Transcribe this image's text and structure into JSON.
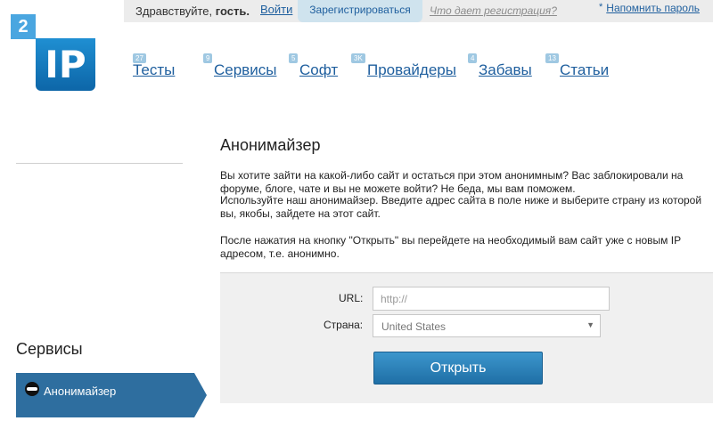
{
  "topbar": {
    "greeting": "Здравствуйте,",
    "username": "гость.",
    "login": "Войти",
    "register": "Зарегистрироваться",
    "register_info": "Что дает регистрация?",
    "remind_star": "*",
    "remind": "Напомнить пароль"
  },
  "logo": {
    "top": "2",
    "main": "IP"
  },
  "nav": [
    {
      "badge": "27",
      "label": "Тесты"
    },
    {
      "badge": "9",
      "label": "Сервисы"
    },
    {
      "badge": "5",
      "label": "Софт"
    },
    {
      "badge": "3K",
      "label": "Провайдеры"
    },
    {
      "badge": "4",
      "label": "Забавы"
    },
    {
      "badge": "13",
      "label": "Статьи"
    }
  ],
  "sidebar": {
    "title": "Сервисы",
    "active_item": {
      "label": "Анонимайзер",
      "icon": "ninja-icon"
    }
  },
  "main": {
    "title": "Анонимайзер",
    "para1": "Вы хотите зайти на какой-либо сайт и остаться при этом анонимным? Вас заблокировали на форуме, блоге, чате и вы не можете войти? Не беда, мы вам поможем.",
    "para2": "Используйте наш анонимайзер. Введите адрес сайта в поле ниже и выберите страну из которой вы, якобы, зайдете на этот сайт.",
    "para3": "После нажатия на кнопку \"Открыть\" вы перейдете на необходимый вам сайт уже с новым IP адресом, т.е. анонимно."
  },
  "form": {
    "url_label": "URL:",
    "url_placeholder": "http://",
    "url_value": "",
    "country_label": "Страна:",
    "country_value": "United States",
    "select_arrow": "▼",
    "submit": "Открыть"
  },
  "colors": {
    "accent": "#1f5f9e",
    "logo_blue": "#1f8fd2",
    "sidebar_active": "#2e6e9f"
  }
}
